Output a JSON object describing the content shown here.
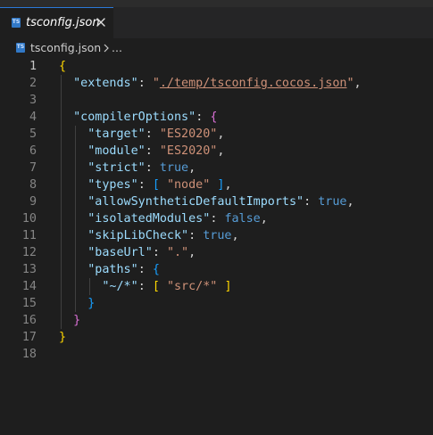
{
  "tab": {
    "icon_text": "TS",
    "label": "tsconfig.json",
    "close_glyph": "close-icon"
  },
  "breadcrumb": {
    "icon_text": "TS",
    "file": "tsconfig.json",
    "more": "..."
  },
  "editor": {
    "active_line": 1,
    "line_numbers": [
      "1",
      "2",
      "3",
      "4",
      "5",
      "6",
      "7",
      "8",
      "9",
      "10",
      "11",
      "12",
      "13",
      "14",
      "15",
      "16",
      "17",
      "18"
    ],
    "lines": [
      "{",
      "  \"extends\": \"./temp/tsconfig.cocos.json\",",
      "",
      "  \"compilerOptions\": {",
      "    \"target\": \"ES2020\",",
      "    \"module\": \"ES2020\",",
      "    \"strict\": true,",
      "    \"types\": [ \"node\" ],",
      "    \"allowSyntheticDefaultImports\": true,",
      "    \"isolatedModules\": false,",
      "    \"skipLibCheck\": true,",
      "    \"baseUrl\": \".\",",
      "    \"paths\": {",
      "      \"~/*\": [ \"src/*\" ]",
      "    }",
      "  }",
      "}",
      ""
    ]
  },
  "colors": {
    "background": "#1e1e1e",
    "key": "#9cdcfe",
    "string": "#ce9178",
    "boolean": "#569cd6",
    "bracket_level1": "#ffd700",
    "bracket_level2": "#da70d6",
    "bracket_level3": "#179fff",
    "ts_badge": "#3178c6"
  }
}
